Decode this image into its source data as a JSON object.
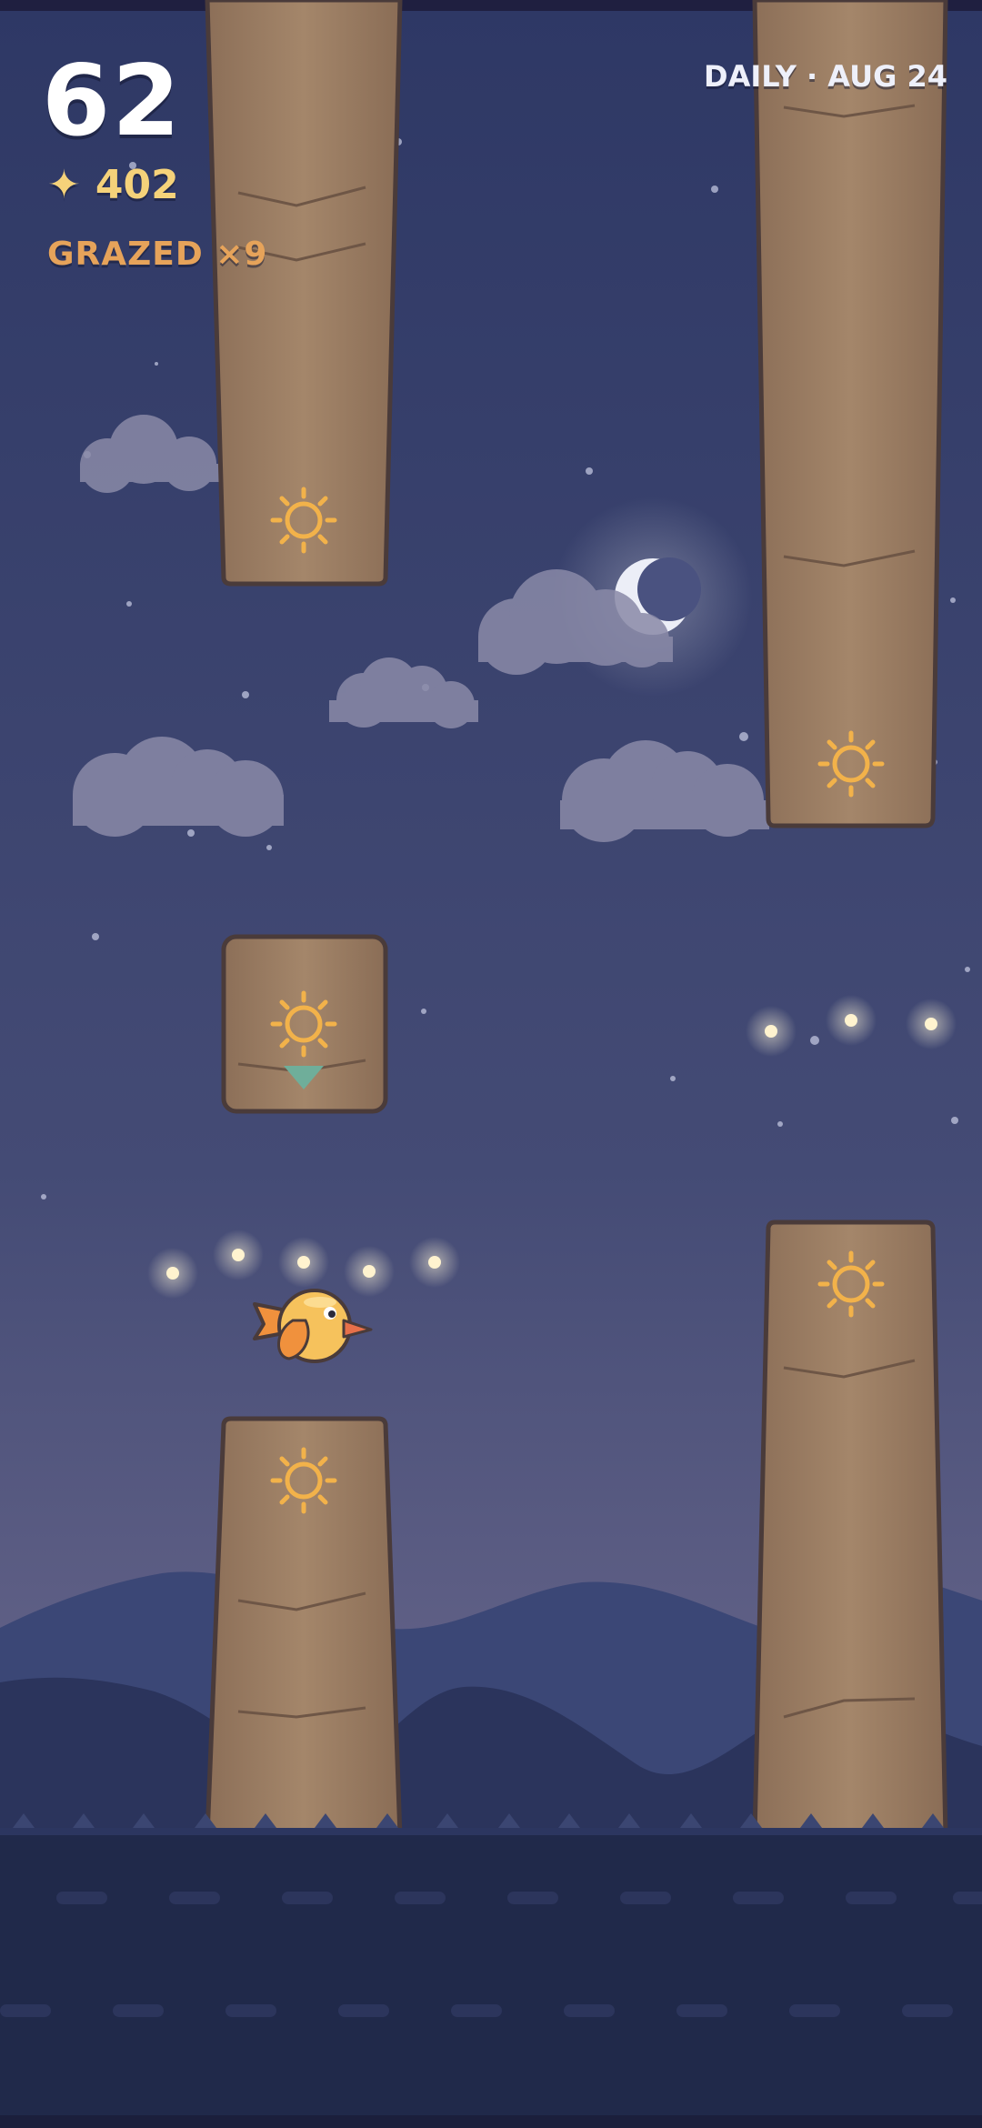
{
  "hud": {
    "score": "62",
    "stars_count": "402",
    "star_icon": "sparkle-star-icon",
    "grazed_label": "GRAZED ×9",
    "daily_label": "DAILY · AUG 24"
  },
  "scene": {
    "time_of_day": "night",
    "colors": {
      "sky_top": "#2f3a66",
      "sky_bottom": "#5b5f86",
      "pillar": "#9a7c62",
      "pillar_outline": "#4a3b3a",
      "glyph": "#f2b24a",
      "ground": "#20294a",
      "mountain_far": "#3d4a78",
      "mountain_near": "#2d375f",
      "bird_body": "#f6c25c",
      "bird_wing": "#f0913d",
      "orb": "#fff3cf",
      "marker": "#6fae9a"
    },
    "pillar_icon": "sun-glyph-icon",
    "moon_icon": "crescent-moon-icon",
    "player_icon": "bird-icon"
  }
}
